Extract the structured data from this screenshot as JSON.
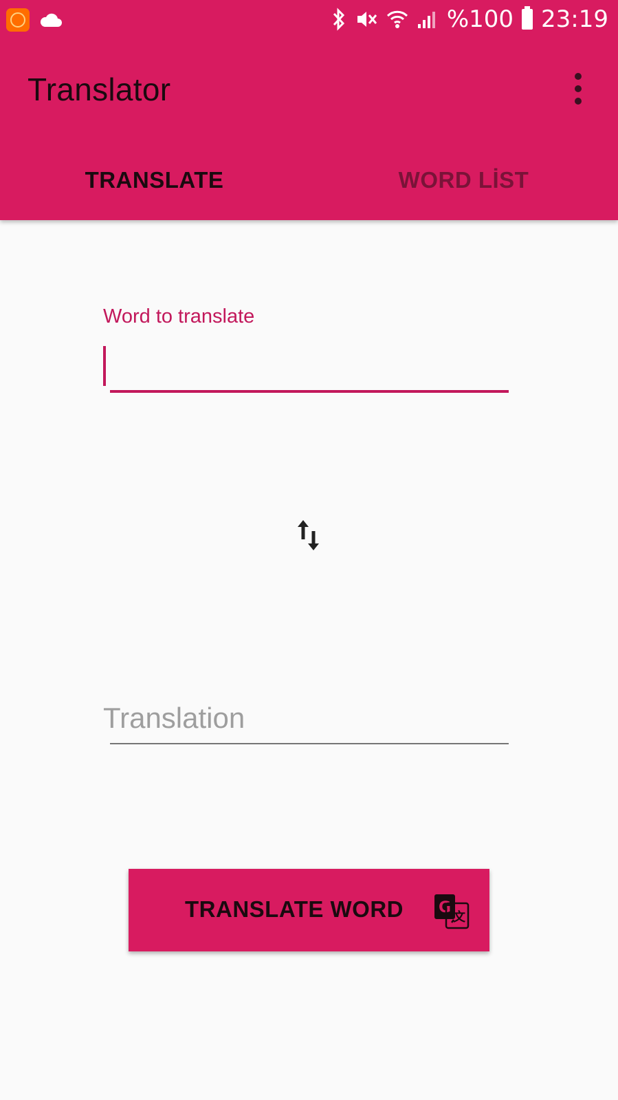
{
  "status_bar": {
    "battery_text": "%100",
    "time": "23:19",
    "left_icons": [
      "app-notification-icon",
      "cloud-icon"
    ],
    "right_icons": [
      "bluetooth-icon",
      "vibrate-icon",
      "wifi-icon",
      "signal-icon",
      "battery-icon"
    ]
  },
  "toolbar": {
    "title": "Translator",
    "menu_icon": "more-vert-icon"
  },
  "tabs": [
    {
      "label": "TRANSLATE",
      "selected": true
    },
    {
      "label": "WORD LİST",
      "selected": false
    }
  ],
  "form": {
    "word_label": "Word to translate",
    "word_value": "",
    "swap_icon": "swap-vertical-icon",
    "translation_hint": "Translation",
    "translation_value": ""
  },
  "button": {
    "label": "TRANSLATE WORD",
    "icon": "google-translate-icon"
  },
  "colors": {
    "primary": "#d81b60",
    "accent": "#c2185b",
    "background": "#fafafa"
  }
}
